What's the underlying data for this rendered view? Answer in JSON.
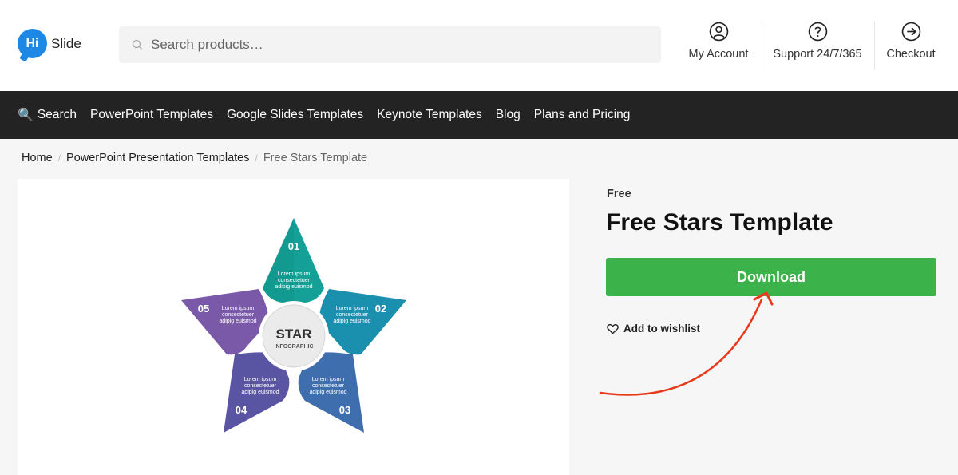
{
  "brand": {
    "badge": "Hi",
    "name": "Slide",
    "color": "#1e88e5"
  },
  "search": {
    "placeholder": "Search products…"
  },
  "header_links": [
    {
      "label": "My Account",
      "icon": "user-circle-icon"
    },
    {
      "label": "Support 24/7/365",
      "icon": "help-circle-icon"
    },
    {
      "label": "Checkout",
      "icon": "arrow-right-circle-icon"
    }
  ],
  "nav": {
    "items": [
      "Search",
      "PowerPoint Templates",
      "Google Slides Templates",
      "Keynote Templates",
      "Blog",
      "Plans and Pricing"
    ]
  },
  "breadcrumb": {
    "items": [
      "Home",
      "PowerPoint Presentation Templates"
    ],
    "current": "Free Stars Template"
  },
  "infographic": {
    "center_title": "STAR",
    "center_subtitle": "INFOGRAPHIC",
    "points": [
      {
        "number": "01",
        "lines": [
          "Lorem ipsum",
          "consectetuer",
          "adipig euismod"
        ],
        "color": "#14a097"
      },
      {
        "number": "02",
        "lines": [
          "Lorem ipsum",
          "consectetuer",
          "adipig euismod"
        ],
        "color": "#1a8fae"
      },
      {
        "number": "03",
        "lines": [
          "Lorem ipsum",
          "consectetuer",
          "adipig euismod"
        ],
        "color": "#3f6eae"
      },
      {
        "number": "04",
        "lines": [
          "Lorem ipsum",
          "consectetuer",
          "adipig euismod"
        ],
        "color": "#5a55a2"
      },
      {
        "number": "05",
        "lines": [
          "Lorem ipsum",
          "consectetuer",
          "adipig euismod"
        ],
        "color": "#7a5aa8"
      }
    ]
  },
  "product": {
    "price": "Free",
    "title": "Free Stars Template",
    "download_label": "Download",
    "wishlist_label": "Add to wishlist",
    "accent_green": "#3cb34a",
    "annotation_color": "#e8391a"
  }
}
